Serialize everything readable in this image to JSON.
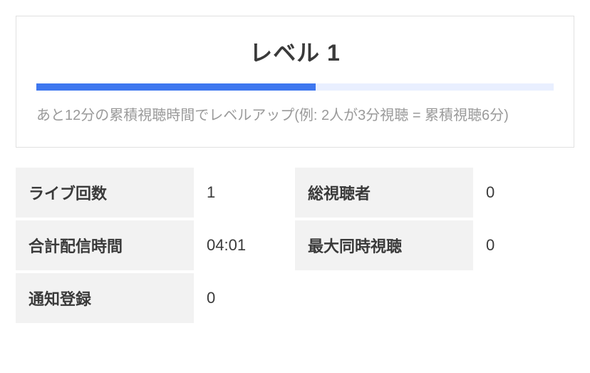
{
  "level": {
    "title": "レベル 1",
    "progress_percent": 54,
    "description": "あと12分の累積視聴時間でレベルアップ(例: 2人が3分視聴 = 累積視聴6分)"
  },
  "stats": {
    "live_count": {
      "label": "ライブ回数",
      "value": "1"
    },
    "total_viewers": {
      "label": "総視聴者",
      "value": "0"
    },
    "total_stream_time": {
      "label": "合計配信時間",
      "value": "04:01"
    },
    "max_concurrent": {
      "label": "最大同時視聴",
      "value": "0"
    },
    "notification_subs": {
      "label": "通知登録",
      "value": "0"
    }
  }
}
